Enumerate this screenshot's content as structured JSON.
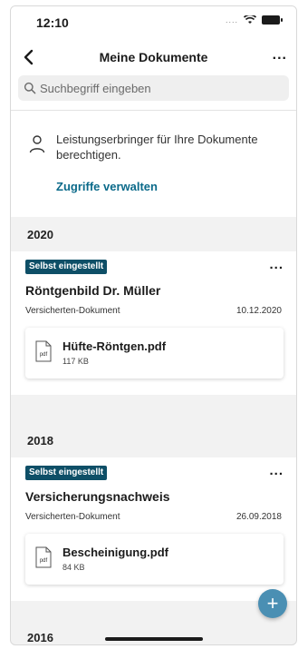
{
  "status_bar": {
    "time": "12:10",
    "signal": "....",
    "battery_icon": "battery-icon",
    "wifi_icon": "wifi-icon"
  },
  "nav": {
    "title": "Meine Dokumente",
    "back_icon": "chevron-left-icon",
    "more": "..."
  },
  "search": {
    "placeholder": "Suchbegriff eingeben",
    "value": ""
  },
  "info": {
    "icon": "person-icon",
    "text": "Leistungserbringer für Ihre Dokumente berechtigen.",
    "link": "Zugriffe verwalten"
  },
  "colors": {
    "accent": "#0b6a8a",
    "badge": "#0e4f67",
    "fab": "#4a8fb3",
    "background": "#f2f2f2"
  },
  "sections": [
    {
      "year": "2020",
      "documents": [
        {
          "badge": "Selbst eingestellt",
          "more": "...",
          "title": "Röntgenbild Dr. Müller",
          "type": "Versicherten-Dokument",
          "date": "10.12.2020",
          "file": {
            "icon_label": "pdf",
            "name": "Hüfte-Röntgen.pdf",
            "size": "117 KB"
          }
        }
      ]
    },
    {
      "year": "2018",
      "documents": [
        {
          "badge": "Selbst eingestellt",
          "more": "...",
          "title": "Versicherungsnachweis",
          "type": "Versicherten-Dokument",
          "date": "26.09.2018",
          "file": {
            "icon_label": "pdf",
            "name": "Bescheinigung.pdf",
            "size": "84 KB"
          }
        }
      ]
    },
    {
      "year": "2016",
      "documents": []
    }
  ],
  "fab": {
    "label": "+"
  }
}
